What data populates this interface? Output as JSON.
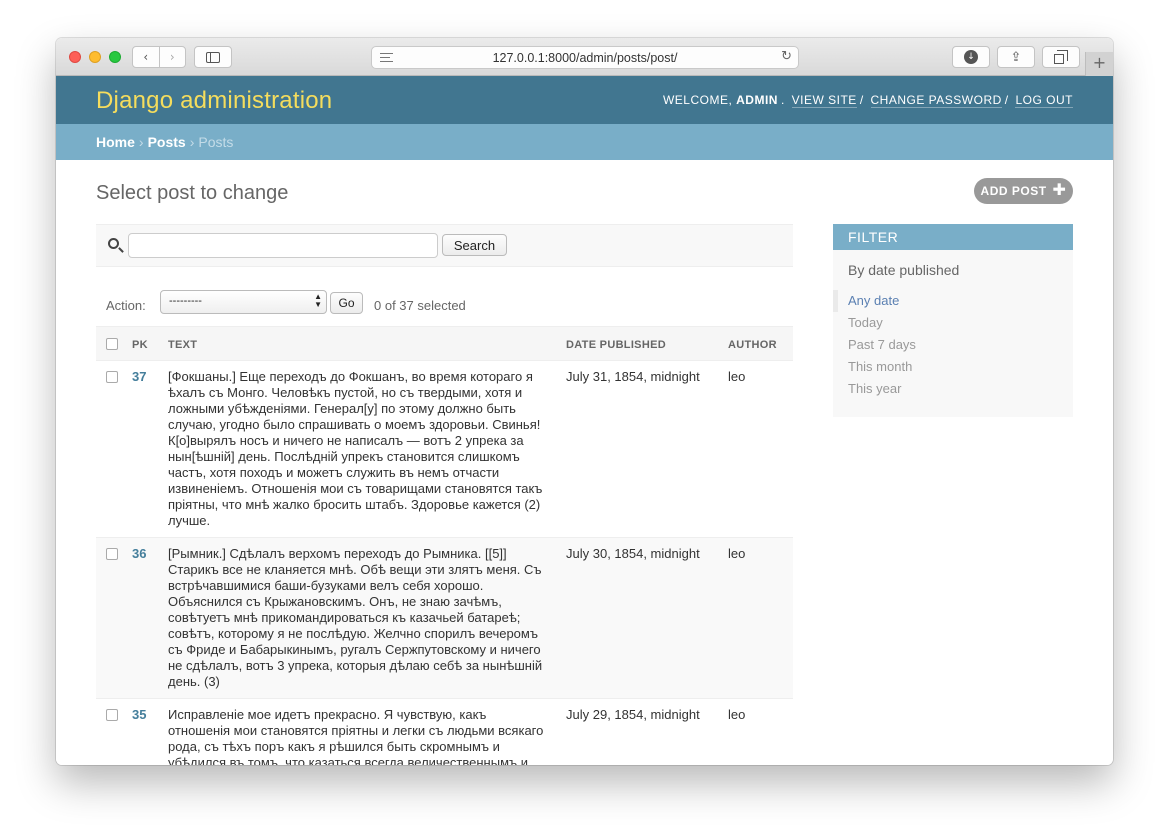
{
  "browser": {
    "url": "127.0.0.1:8000/admin/posts/post/",
    "nav_back": "‹",
    "nav_forward": "›",
    "reload": "↻",
    "share": "⇪",
    "new_tab": "+"
  },
  "header": {
    "site_name": "Django administration",
    "welcome": "Welcome, ",
    "username": "admin",
    "links": [
      "View site",
      "Change password",
      "Log out"
    ]
  },
  "breadcrumbs": {
    "home": "Home",
    "app": "Posts",
    "current": "Posts"
  },
  "content": {
    "title": "Select post to change",
    "add_button": "Add post"
  },
  "search": {
    "button_label": "Search",
    "value": ""
  },
  "actions": {
    "label": "Action:",
    "selected_option": "---------",
    "go_label": "Go",
    "counter": "0 of 37 selected"
  },
  "table": {
    "columns": [
      "PK",
      "Text",
      "Date published",
      "Author"
    ],
    "rows": [
      {
        "pk": "37",
        "text": "[Фокшаны.] Еще переходъ до Фокшанъ, во время котораго я ѣхалъ съ Монго. Человѣкъ пустой, но съ твердыми, хотя и ложными убѣжденіями. Генерал[у] по этому должно быть случаю, угодно было спрашивать о моемъ здоровьи. Свинья! К[о]вырялъ носъ и ничего не написалъ — вотъ 2 упрека за нын[ѣшній] день. Послѣдній упрекъ становится слишкомъ частъ, хотя походъ и можетъ служить въ немъ отчасти извиненіемъ. Отношенія мои съ товарищами становятся такъ пріятны, что мнѣ жалко бросить штабъ. Здоровье кажется (2) лучше.",
        "date": "July 31, 1854, midnight",
        "author": "leo"
      },
      {
        "pk": "36",
        "text": "[Рымник.] Сдѣлалъ верхомъ переходъ до Рымника. [[5]] Старикъ все не кланяется мнѣ. Обѣ вещи эти злятъ меня. Съ встрѣчавшимися баши-бузуками велъ себя хорошо. Объяснился съ Крыжановскимъ. Онъ, не знаю зачѣмъ, совѣтуетъ мнѣ прикомандироваться къ казачьей батареѣ; совѣтъ, которому я не послѣдую. Желчно спорилъ вечеромъ съ Фриде и Бабарыкинымъ, ругалъ Сержпутовскому и ничего не сдѣлалъ, вотъ 3 упрека, которыя дѣлаю себѣ за нынѣшній день. (3)",
        "date": "July 30, 1854, midnight",
        "author": "leo"
      },
      {
        "pk": "35",
        "text": "Исправленіе мое идетъ прекрасно. Я чувствую, какъ отношенія мои становятся пріятны и легки съ людьми всякаго рода, съ тѣхъ поръ какъ я рѣшился быть скромнымъ и убѣдился въ томъ, что казаться всегда величественнымъ и",
        "date": "July 29, 1854, midnight",
        "author": "leo"
      }
    ]
  },
  "filter": {
    "title": "Filter",
    "heading": "By date published",
    "options": [
      "Any date",
      "Today",
      "Past 7 days",
      "This month",
      "This year"
    ],
    "selected": "Any date"
  },
  "colors": {
    "header_bg": "#417690",
    "site_name": "#f5dd5d",
    "breadcrumbs_bg": "#79aec8",
    "link": "#447e9b"
  }
}
